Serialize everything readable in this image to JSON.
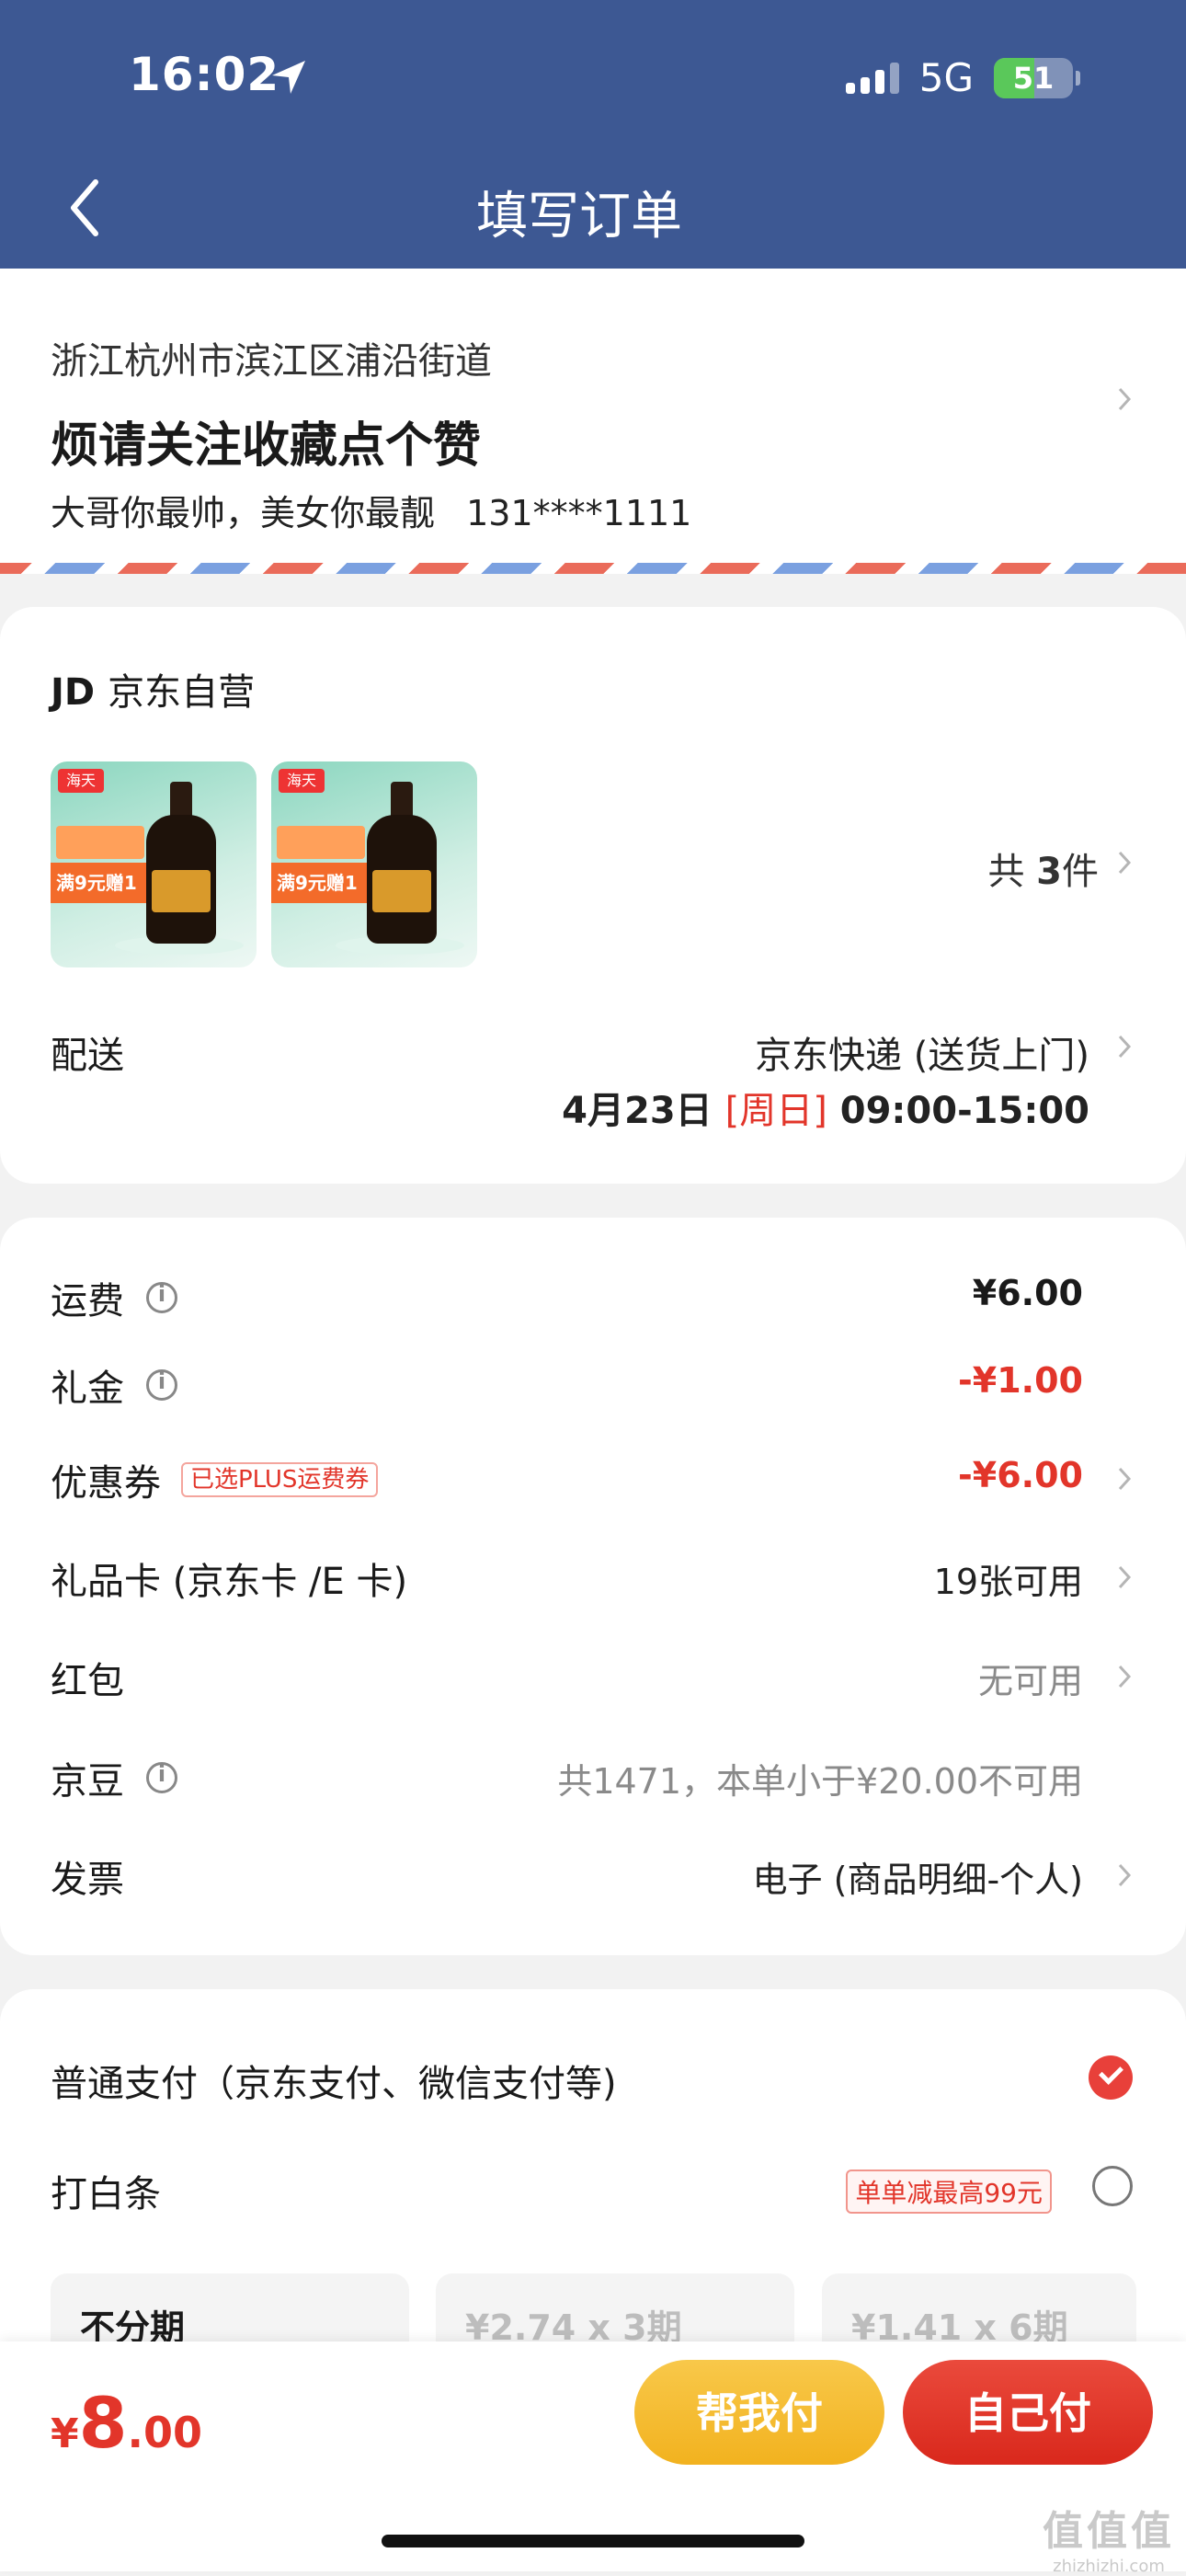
{
  "status_bar": {
    "time": "16:02",
    "network": "5G",
    "battery_level": "51",
    "battery_fraction": 0.51
  },
  "header": {
    "title": "填写订单",
    "background": "#3d5893"
  },
  "address": {
    "region": "浙江杭州市滨江区浦沿街道",
    "recipient_line": "烦请关注收藏点个赞",
    "contact_name": "大哥你最帅，美女你最靓",
    "phone": "131****1111"
  },
  "goods": {
    "store_logo": "JD",
    "store_name": "京东自营",
    "thumbnails": [
      {
        "brand": "海天",
        "promo": "满9元赠1"
      },
      {
        "brand": "海天",
        "promo": "满9元赠1"
      }
    ],
    "count_prefix": "共",
    "count_value": "3",
    "count_suffix": "件",
    "delivery_label": "配送",
    "delivery_method": "京东快递 (送货上门)",
    "delivery_date": "4月23日",
    "delivery_day": "[周日]",
    "delivery_window": "09:00-15:00"
  },
  "fees": {
    "freight": {
      "label": "运费",
      "value": "¥6.00"
    },
    "gift_money": {
      "label": "礼金",
      "value": "-¥1.00"
    },
    "coupon": {
      "label": "优惠券",
      "tag": "已选PLUS运费券",
      "value": "-¥6.00"
    },
    "gift_card": {
      "label": "礼品卡 (京东卡 /E 卡)",
      "value": "19张可用"
    },
    "red_packet": {
      "label": "红包",
      "value": "无可用"
    },
    "jingdou": {
      "label": "京豆",
      "value": "共1471，本单小于¥20.00不可用"
    },
    "invoice": {
      "label": "发票",
      "value": "电子 (商品明细-个人)"
    }
  },
  "payment": {
    "normal": {
      "label": "普通支付（京东支付、微信支付等)",
      "selected": true
    },
    "baitiao": {
      "label": "打白条",
      "tag": "单单减最高99元",
      "selected": false
    },
    "plans": [
      {
        "label": "不分期",
        "selected": true
      },
      {
        "label": "¥2.74 x 3期",
        "selected": false
      },
      {
        "label": "¥1.41 x 6期",
        "selected": false
      }
    ]
  },
  "bottom": {
    "currency": "¥",
    "total_int": "8",
    "total_dec": ".00",
    "help_pay": "帮我付",
    "self_pay": "自己付",
    "watermark": "值值值",
    "watermark_url": "zhizhizhi.com"
  },
  "colors": {
    "accent_red": "#e2352a",
    "yellow_button": "#f2b21f",
    "header_blue": "#3d5893"
  }
}
